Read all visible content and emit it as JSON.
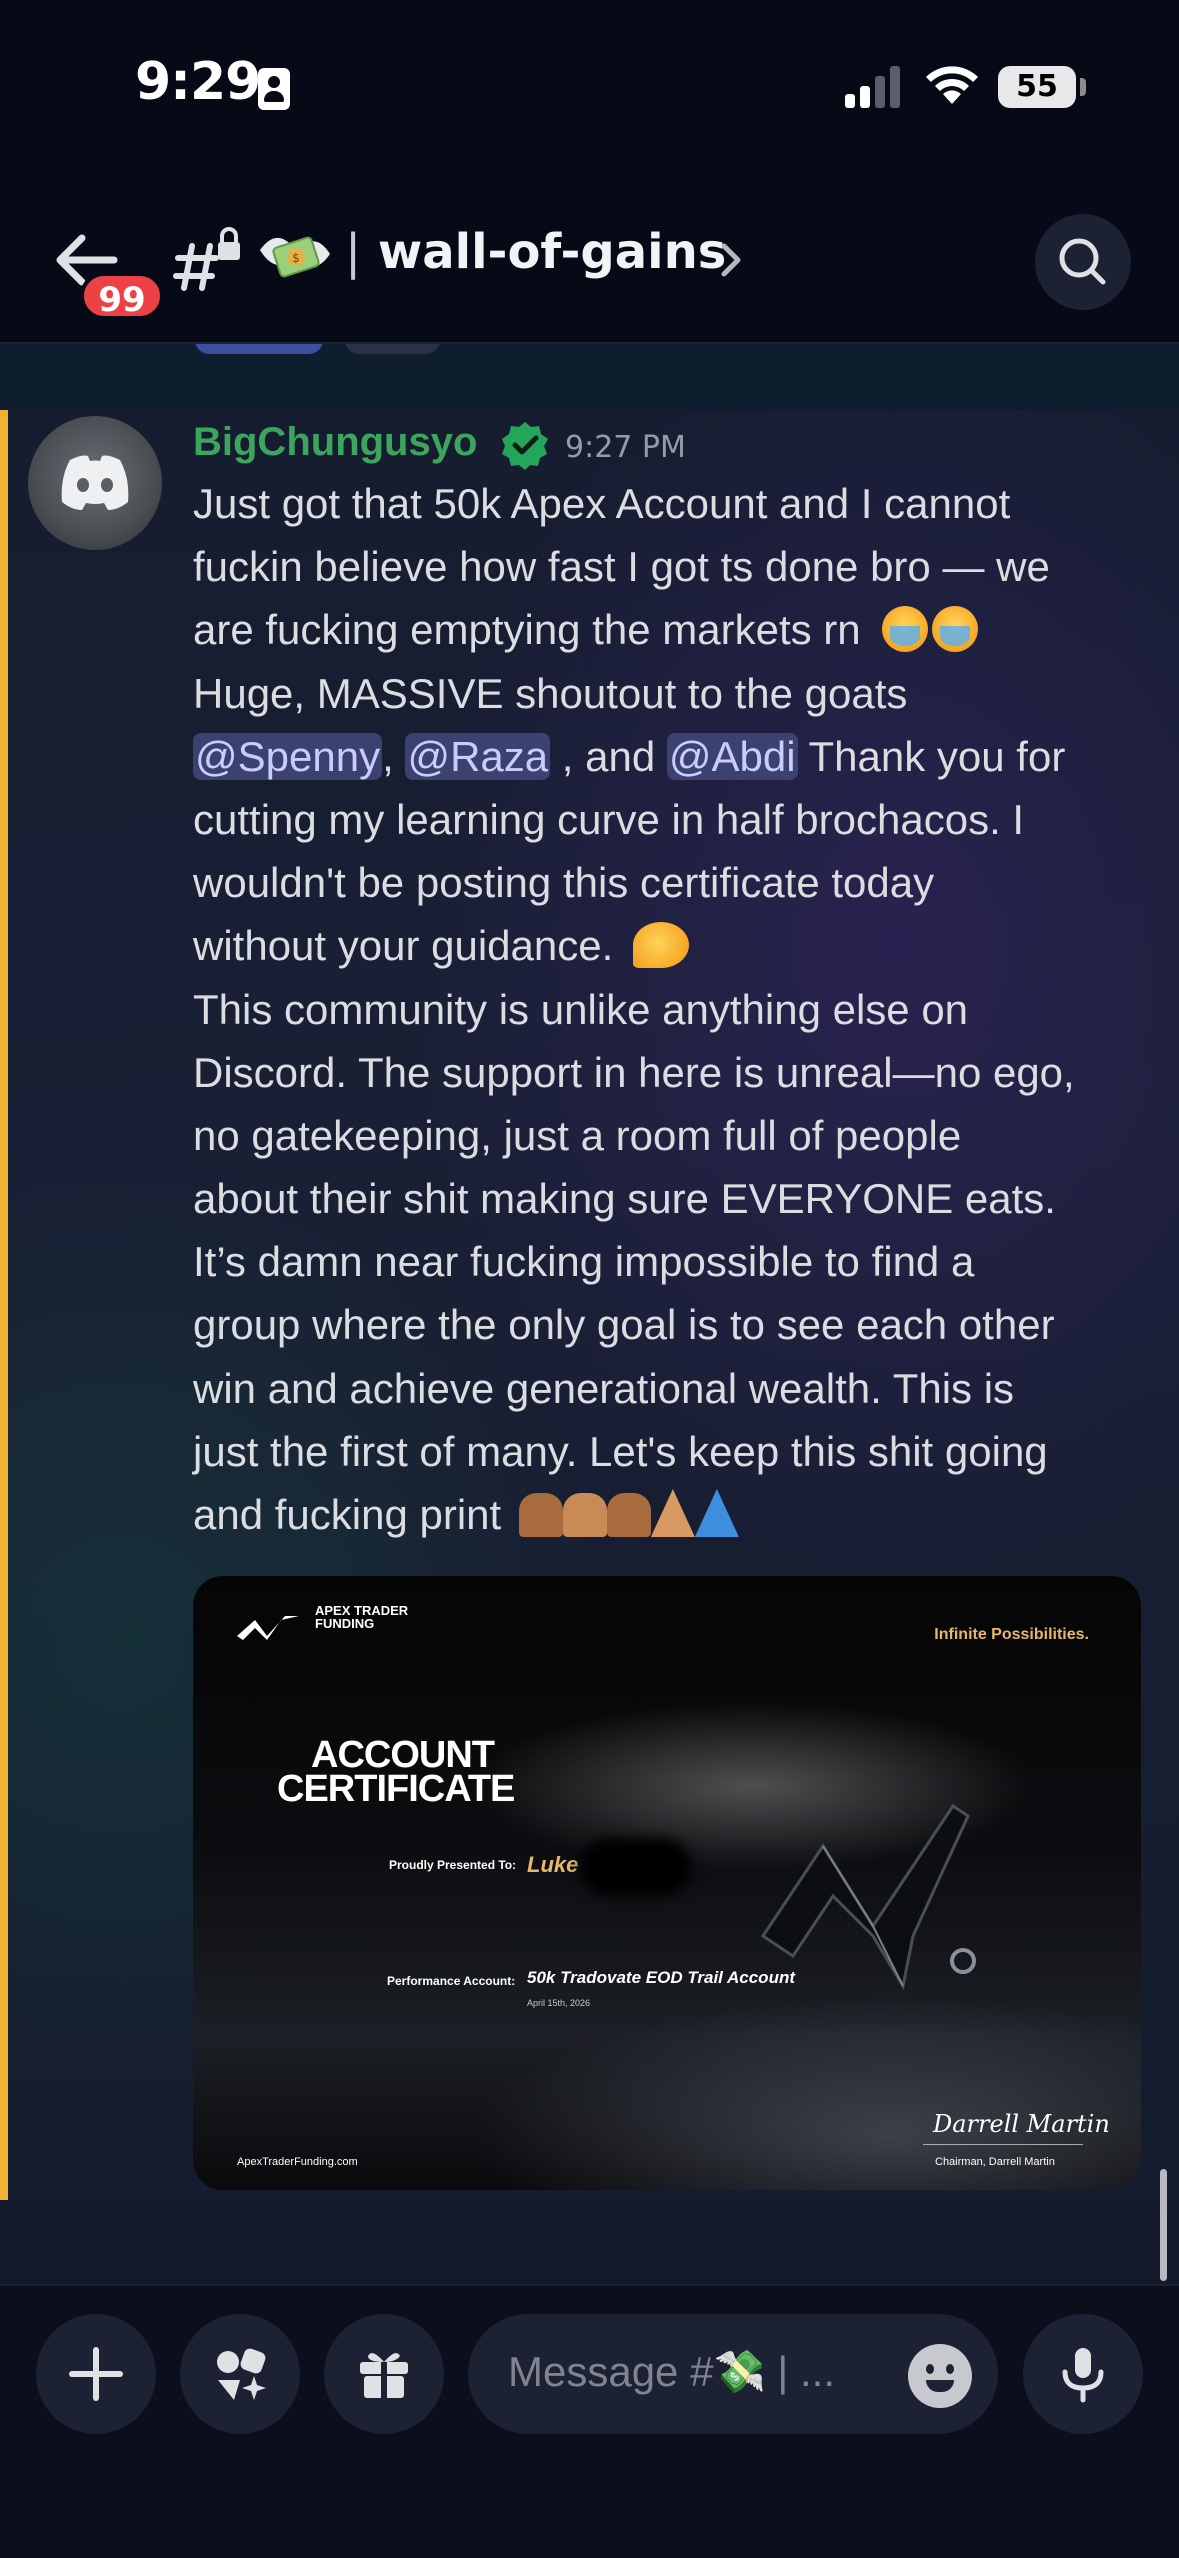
{
  "status_bar": {
    "time": "9:29",
    "battery": "55"
  },
  "header": {
    "unread_badge": "99",
    "channel_name": "wall-of-gains",
    "separator": "|"
  },
  "message": {
    "author": "BigChungusyo",
    "time": "9:27 PM",
    "lines": [
      "Just got that 50k Apex Account  and I cannot",
      "fuckin believe how fast I got ts done bro — we",
      "are fucking emptying the markets rn",
      "Huge, MASSIVE shoutout to the goats",
      "",
      "cutting my learning curve in half brochacos. I",
      "wouldn't be posting this certificate today",
      "without your guidance.",
      "This community is unlike anything else on",
      "Discord. The support in here is unreal—no ego,",
      "no gatekeeping, just a room full of people",
      "about their shit making sure EVERYONE eats.",
      "It’s damn near fucking impossible to find a",
      "group where the only goal is to see each other",
      "win and achieve generational wealth. This is",
      "just the first of many. Let's keep this shit going",
      "and fucking print"
    ],
    "mentions": [
      "@Spenny",
      "@Raza",
      "@Abdi"
    ],
    "mention_connectors": [
      ",",
      ", and"
    ],
    "mention_line_tail": "Thank you for",
    "certificate": {
      "brand": "APEX TRADER FUNDING",
      "tagline": "Infinite Possibilities.",
      "title_line1": "ACCOUNT",
      "title_line2": "CERTIFICATE",
      "presented_label": "Proudly Presented To:",
      "recipient": "Luke",
      "account_label": "Performance Account:",
      "account": "50k Tradovate EOD Trail Account",
      "date": "April 15th, 2026",
      "url": "ApexTraderFunding.com",
      "signature": "Darrell Martin",
      "signer": "Chairman, Darrell Martin"
    }
  },
  "composer": {
    "placeholder": "Message #💸 | ..."
  },
  "colors": {
    "mention_bar": "#f0b232",
    "username": "#3ba55d",
    "badge": "#ed4245"
  },
  "icons": [
    "back-arrow-icon",
    "hash-lock-icon",
    "money-wings-icon",
    "chevron-right-icon",
    "search-icon",
    "plus-icon",
    "apps-icon",
    "gift-icon",
    "emoji-icon",
    "microphone-icon",
    "verified-icon",
    "discord-logo-icon"
  ]
}
